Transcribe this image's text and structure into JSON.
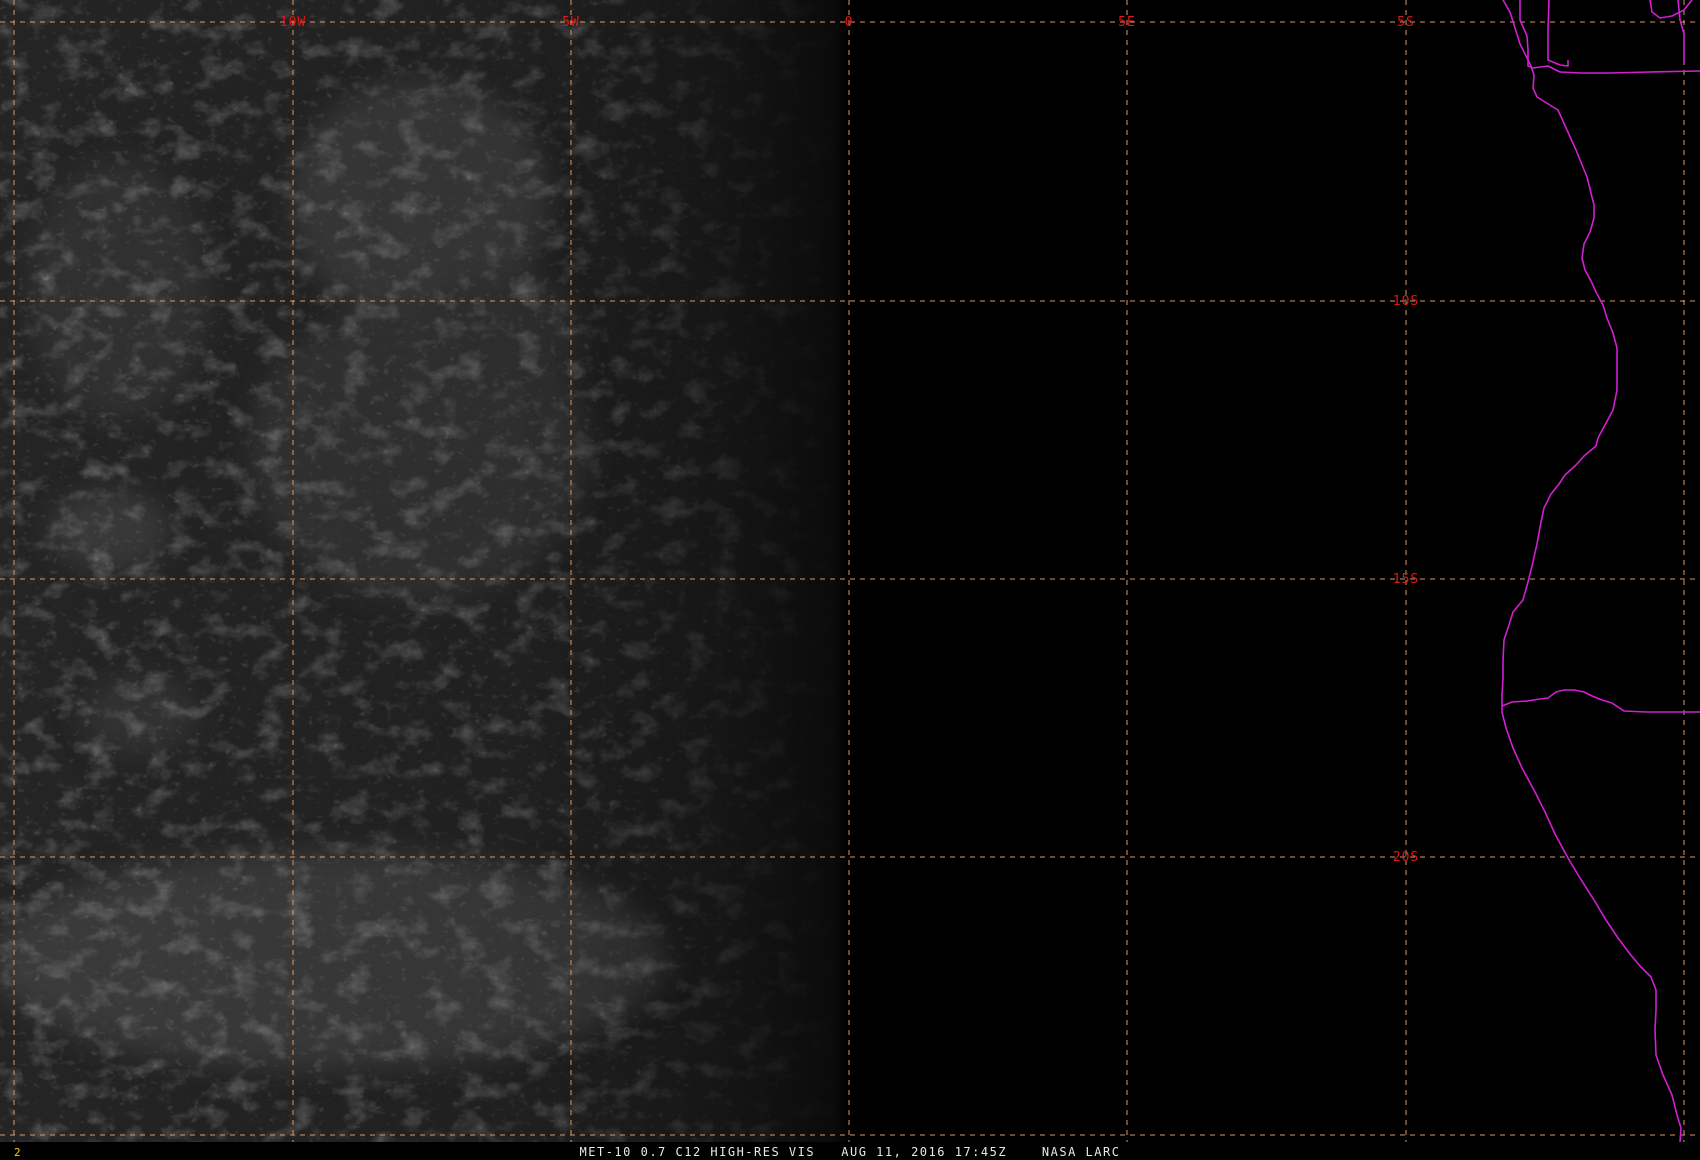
{
  "caption": "MET-10 0.7 C12 HIGH-RES VIS   AUG 11, 2016 17:45Z    NASA LARC",
  "frame_number": "2",
  "colors": {
    "gridline": "#d89a66",
    "grid_label": "#e01818",
    "boundary": "#d21fd2",
    "frame_number": "#ffd400",
    "caption": "#e8e8e8",
    "background": "#000000"
  },
  "grid": {
    "longitude_labels": [
      "10W",
      "5W",
      "0",
      "5E"
    ],
    "latitude_labels": [
      "5S",
      "10S",
      "15S",
      "20S"
    ]
  }
}
